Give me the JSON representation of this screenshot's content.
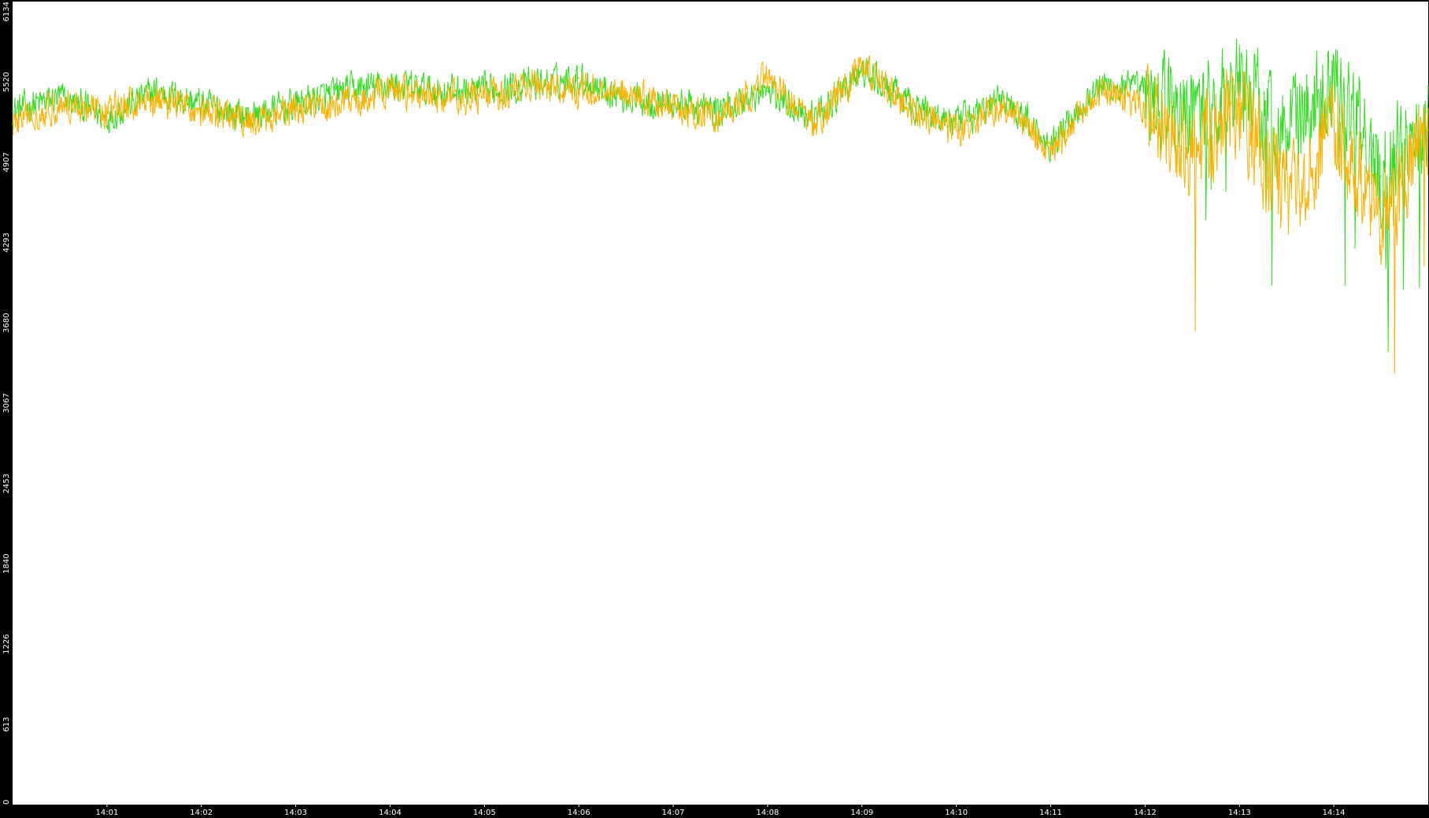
{
  "chart_data": {
    "type": "line",
    "title": "",
    "xlabel": "",
    "ylabel": "",
    "grid": false,
    "legend": "none",
    "background_color": "#ffffff",
    "frame_color": "#000000",
    "tick_label_color": "#ffffff",
    "ylim": [
      0,
      6134
    ],
    "xlim": [
      "14:00:00",
      "14:15:00"
    ],
    "y_ticks": [
      {
        "value": 0,
        "label": "0"
      },
      {
        "value": 613,
        "label": "613"
      },
      {
        "value": 1226,
        "label": "1226"
      },
      {
        "value": 1840,
        "label": "1840"
      },
      {
        "value": 2453,
        "label": "2453"
      },
      {
        "value": 3067,
        "label": "3067"
      },
      {
        "value": 3680,
        "label": "3680"
      },
      {
        "value": 4293,
        "label": "4293"
      },
      {
        "value": 4907,
        "label": "4907"
      },
      {
        "value": 5520,
        "label": "5520"
      },
      {
        "value": 6134,
        "label": "6134"
      }
    ],
    "x_ticks": [
      {
        "value": "14:01:00",
        "label": "14:01"
      },
      {
        "value": "14:02:00",
        "label": "14:02"
      },
      {
        "value": "14:03:00",
        "label": "14:03"
      },
      {
        "value": "14:04:00",
        "label": "14:04"
      },
      {
        "value": "14:05:00",
        "label": "14:05"
      },
      {
        "value": "14:06:00",
        "label": "14:06"
      },
      {
        "value": "14:07:00",
        "label": "14:07"
      },
      {
        "value": "14:08:00",
        "label": "14:08"
      },
      {
        "value": "14:09:00",
        "label": "14:09"
      },
      {
        "value": "14:10:00",
        "label": "14:10"
      },
      {
        "value": "14:11:00",
        "label": "14:11"
      },
      {
        "value": "14:12:00",
        "label": "14:12"
      },
      {
        "value": "14:13:00",
        "label": "14:13"
      },
      {
        "value": "14:14:00",
        "label": "14:14"
      }
    ],
    "series": [
      {
        "color": "#33dd22",
        "x": [
          "14:00:00",
          "14:00:30",
          "14:01:00",
          "14:01:30",
          "14:02:00",
          "14:02:30",
          "14:03:00",
          "14:03:30",
          "14:04:00",
          "14:04:30",
          "14:05:00",
          "14:05:30",
          "14:06:00",
          "14:06:30",
          "14:07:00",
          "14:07:30",
          "14:08:00",
          "14:08:30",
          "14:09:00",
          "14:09:30",
          "14:10:00",
          "14:10:30",
          "14:11:00",
          "14:11:30",
          "14:12:00",
          "14:12:30",
          "14:13:00",
          "14:13:30",
          "14:14:00",
          "14:14:30",
          "14:15:00"
        ],
        "values": [
          5300,
          5400,
          5250,
          5450,
          5350,
          5250,
          5350,
          5450,
          5500,
          5450,
          5450,
          5500,
          5550,
          5400,
          5350,
          5300,
          5450,
          5250,
          5600,
          5350,
          5200,
          5400,
          5050,
          5500,
          5450,
          5250,
          5550,
          5100,
          5600,
          4800,
          5300
        ]
      },
      {
        "color": "#ffb000",
        "x": [
          "14:00:00",
          "14:00:30",
          "14:01:00",
          "14:01:30",
          "14:02:00",
          "14:02:30",
          "14:03:00",
          "14:03:30",
          "14:04:00",
          "14:04:30",
          "14:05:00",
          "14:05:30",
          "14:06:00",
          "14:06:30",
          "14:07:00",
          "14:07:30",
          "14:08:00",
          "14:08:30",
          "14:09:00",
          "14:09:30",
          "14:10:00",
          "14:10:30",
          "14:11:00",
          "14:11:30",
          "14:12:00",
          "14:12:30",
          "14:13:00",
          "14:13:30",
          "14:14:00",
          "14:14:30",
          "14:15:00"
        ],
        "values": [
          5200,
          5350,
          5300,
          5400,
          5300,
          5200,
          5300,
          5350,
          5450,
          5400,
          5400,
          5500,
          5450,
          5450,
          5300,
          5250,
          5550,
          5200,
          5650,
          5300,
          5150,
          5350,
          5000,
          5450,
          5350,
          5000,
          5350,
          4600,
          5200,
          4500,
          5150
        ]
      }
    ]
  }
}
